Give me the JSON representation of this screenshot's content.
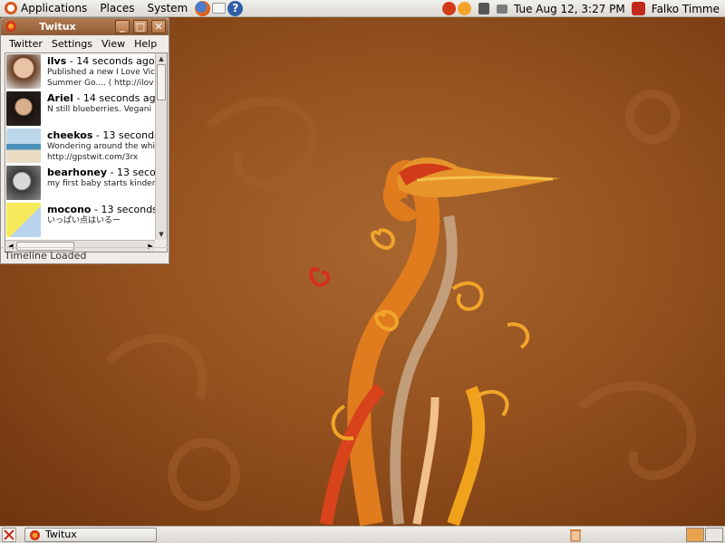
{
  "top_panel": {
    "menus": [
      "Applications",
      "Places",
      "System"
    ],
    "datetime": "Tue Aug 12,  3:27 PM",
    "user": "Falko Timme"
  },
  "window": {
    "title": "Twitux",
    "menus": [
      "Twitter",
      "Settings",
      "View",
      "Help"
    ],
    "status": "Timeline Loaded",
    "tweets": [
      {
        "user": "ilvs",
        "time": " - 14 seconds ago",
        "line1": "Published a new I Love Vic",
        "line2": "Summer Go.... ( http://ilov"
      },
      {
        "user": "Ariel",
        "time": " - 14 seconds ago",
        "line1": "N still blueberries.  Vegani",
        "line2": ""
      },
      {
        "user": "cheekos",
        "time": " - 13 seconds",
        "line1": "Wondering around the whis",
        "line2": "http://gpstwit.com/3rx"
      },
      {
        "user": "bearhoney",
        "time": " - 13 second",
        "line1": "my first baby starts kinder",
        "line2": ""
      },
      {
        "user": "mocono",
        "time": " - 13 seconds a",
        "line1": "いっぱい点はいるー",
        "line2": ""
      }
    ]
  },
  "taskbar": {
    "task_label": "Twitux"
  },
  "colors": {
    "wallpaper": "#95521f",
    "titlebar": "#a06a40",
    "panel": "#e6e3de"
  }
}
